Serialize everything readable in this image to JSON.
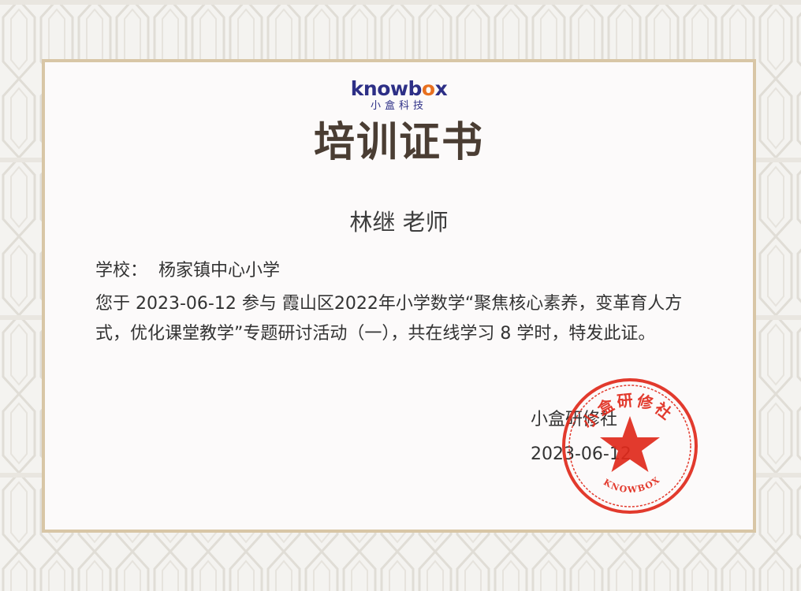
{
  "logo": {
    "word_main": "knowb",
    "word_accent": "o",
    "word_end": "x",
    "subtitle": "小盒科技"
  },
  "certificate": {
    "title": "培训证书",
    "recipient": "林继 老师",
    "school_label": "学校：",
    "school_value": "杨家镇中心小学",
    "statement": "您于 2023-06-12 参与 霞山区2022年小学数学“聚焦核心素养，变革育人方式，优化课堂教学”专题研讨活动（一），共在线学习 8 学时，特发此证。",
    "issuer": "小盒研修社",
    "date": "2023-06-12"
  },
  "stamp": {
    "top_text": "小盒研修社",
    "bottom_text": "KNOWBOX",
    "star_icon": "star-icon"
  },
  "colors": {
    "brand_navy": "#2d2f86",
    "brand_orange": "#e8701f",
    "title_brown": "#4a3d33",
    "frame_tan": "#d8c6a6",
    "stamp_red": "#e02a1c"
  }
}
